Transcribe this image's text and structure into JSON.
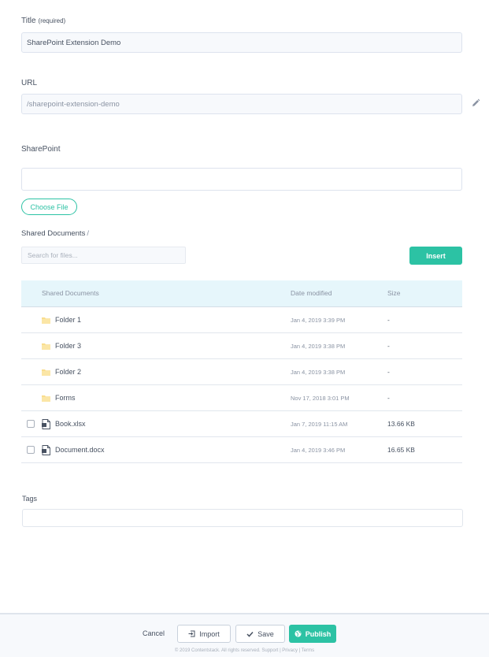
{
  "title_field": {
    "label": "Title",
    "required": "(required)",
    "value": "SharePoint  Extension Demo"
  },
  "url_field": {
    "label": "URL",
    "value": "/sharepoint-extension-demo",
    "edit_icon": "pencil-icon"
  },
  "sharepoint": {
    "label": "SharePoint",
    "input_value": "",
    "choose_file_label": "Choose File",
    "breadcrumb": "Shared Documents",
    "breadcrumb_sep": "/",
    "search_placeholder": "Search for files...",
    "insert_label": "Insert",
    "table": {
      "headers": {
        "name": "Shared Documents",
        "date": "Date modified",
        "size": "Size"
      },
      "rows": [
        {
          "type": "folder",
          "name": "Folder 1",
          "date": "Jan 4, 2019 3:39 PM",
          "size": "-"
        },
        {
          "type": "folder",
          "name": "Folder 3",
          "date": "Jan 4, 2019 3:38 PM",
          "size": "-"
        },
        {
          "type": "folder",
          "name": "Folder 2",
          "date": "Jan 4, 2019 3:38 PM",
          "size": "-"
        },
        {
          "type": "folder",
          "name": "Forms",
          "date": "Nov 17, 2018 3:01 PM",
          "size": "-"
        },
        {
          "type": "file",
          "name": "Book.xlsx",
          "date": "Jan 7, 2019 11:15 AM",
          "size": "13.66 KB"
        },
        {
          "type": "file",
          "name": "Document.docx",
          "date": "Jan 4, 2019 3:46 PM",
          "size": "16.65 KB"
        }
      ]
    }
  },
  "tags_field": {
    "label": "Tags",
    "value": ""
  },
  "footer": {
    "cancel_label": "Cancel",
    "import_label": "Import",
    "save_label": "Save",
    "publish_label": "Publish",
    "copyright": "© 2019 Contentstack. All rights reserved. Support | Privacy | Terms"
  },
  "colors": {
    "accent": "#2cc2a4",
    "table_header_bg": "#e6f6fb",
    "footer_bg": "#f7f9fc"
  }
}
